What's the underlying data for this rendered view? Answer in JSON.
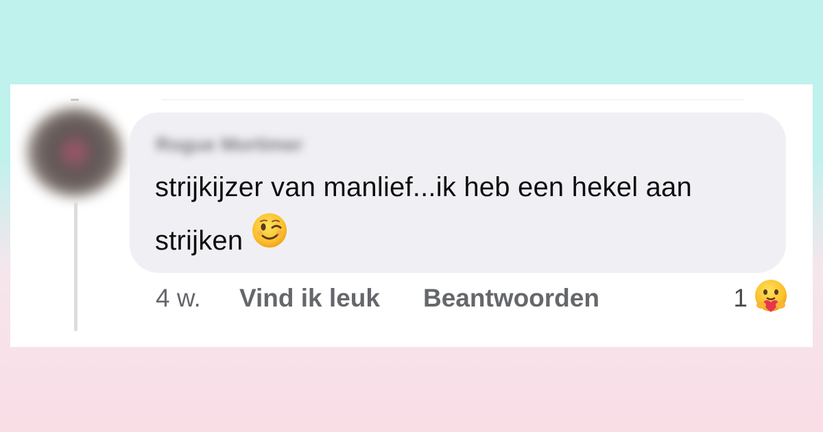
{
  "comment": {
    "author": "Rogue Mortimer",
    "text": "strijkijzer van manlief...ik heb een hekel aan strijken",
    "emoji": "winking-face"
  },
  "actions": {
    "time": "4 w.",
    "like_label": "Vind ik leuk",
    "reply_label": "Beantwoorden"
  },
  "reactions": {
    "count": "1",
    "type": "care-reaction-icon"
  },
  "colors": {
    "bubble": "#f0f0f4",
    "action_text": "#65676b",
    "background_top": "#bff1ed",
    "background_bottom": "#fadde6"
  }
}
